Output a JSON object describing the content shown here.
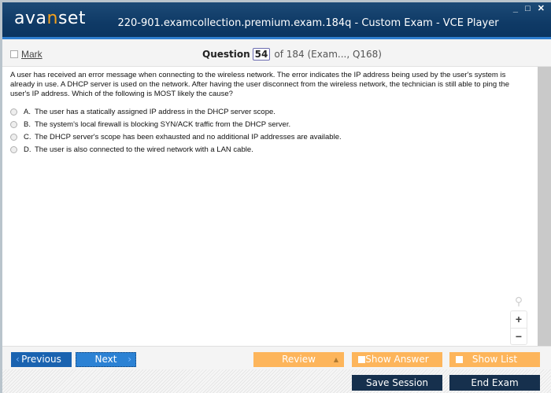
{
  "app": {
    "logo_pre": "ava",
    "logo_accent": "n",
    "logo_post": "set",
    "title": "220-901.examcollection.premium.exam.184q - Custom Exam - VCE Player",
    "window_controls": {
      "minimize": "_",
      "maximize": "□",
      "close": "✕"
    }
  },
  "question_bar": {
    "mark_label": "Mark",
    "question_label": "Question",
    "current": "54",
    "of_text": "of 184 (Exam..., Q168)"
  },
  "question": {
    "text": "A user has received an error message when connecting to the wireless network. The error indicates the IP address being used by the user's system is already in use. A DHCP server is used on the network. After having the user disconnect from the wireless network, the technician is still able to ping the user's IP address. Which of the following is MOST likely the cause?",
    "answers": [
      {
        "letter": "A.",
        "text": "The user has a statically assigned IP address in the DHCP server scope."
      },
      {
        "letter": "B.",
        "text": "The system's local firewall is blocking SYN/ACK traffic from the DHCP server."
      },
      {
        "letter": "C.",
        "text": "The DHCP server's scope has been exhausted and no additional IP addresses are available."
      },
      {
        "letter": "D.",
        "text": "The user is also connected to the wired network with a LAN cable."
      }
    ]
  },
  "zoom_controls": {
    "magnifier": "⚲",
    "zoom_in": "+",
    "zoom_out": "−"
  },
  "nav": {
    "previous": "Previous",
    "next": "Next",
    "review": "Review",
    "show_answer": "Show Answer",
    "show_list": "Show List",
    "prev_chevron": "‹",
    "next_chevron": "›",
    "review_arrow": "▲"
  },
  "footer": {
    "save_session": "Save Session",
    "end_exam": "End Exam"
  },
  "colors": {
    "titlebar": "#0f3a66",
    "accent_orange": "#fdb55b",
    "logo_accent": "#f7a21b",
    "previous_button": "#1a63b0",
    "next_button": "#2c82d4",
    "dark_button": "#16304d"
  }
}
